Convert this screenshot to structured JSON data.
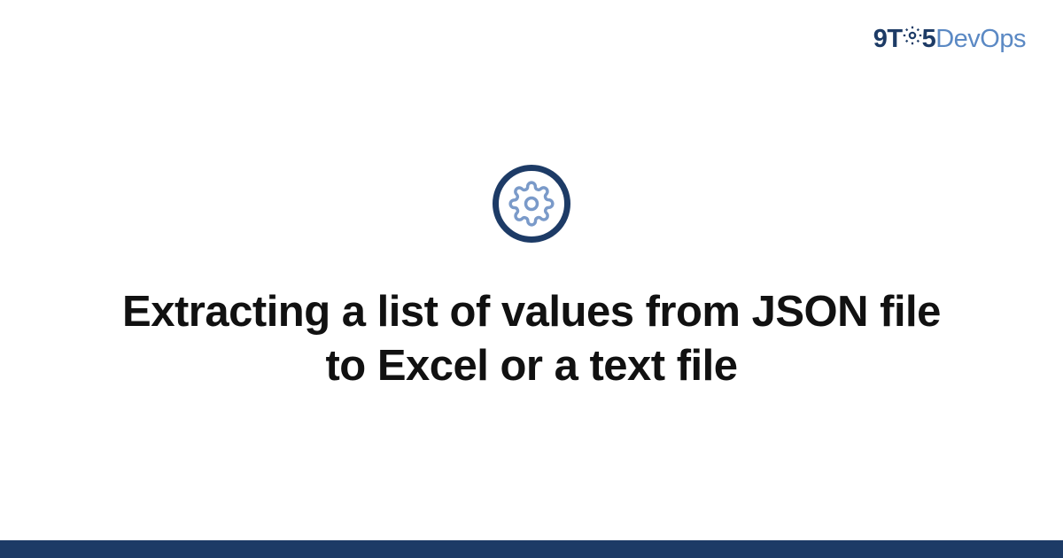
{
  "logo": {
    "part1": "9T",
    "part2": "5",
    "part3": "DevOps"
  },
  "title": "Extracting a list of values from JSON file to Excel or a text file",
  "colors": {
    "primary": "#1d3b66",
    "accent": "#5b89c4",
    "icon_inner": "#7a9ac9"
  }
}
